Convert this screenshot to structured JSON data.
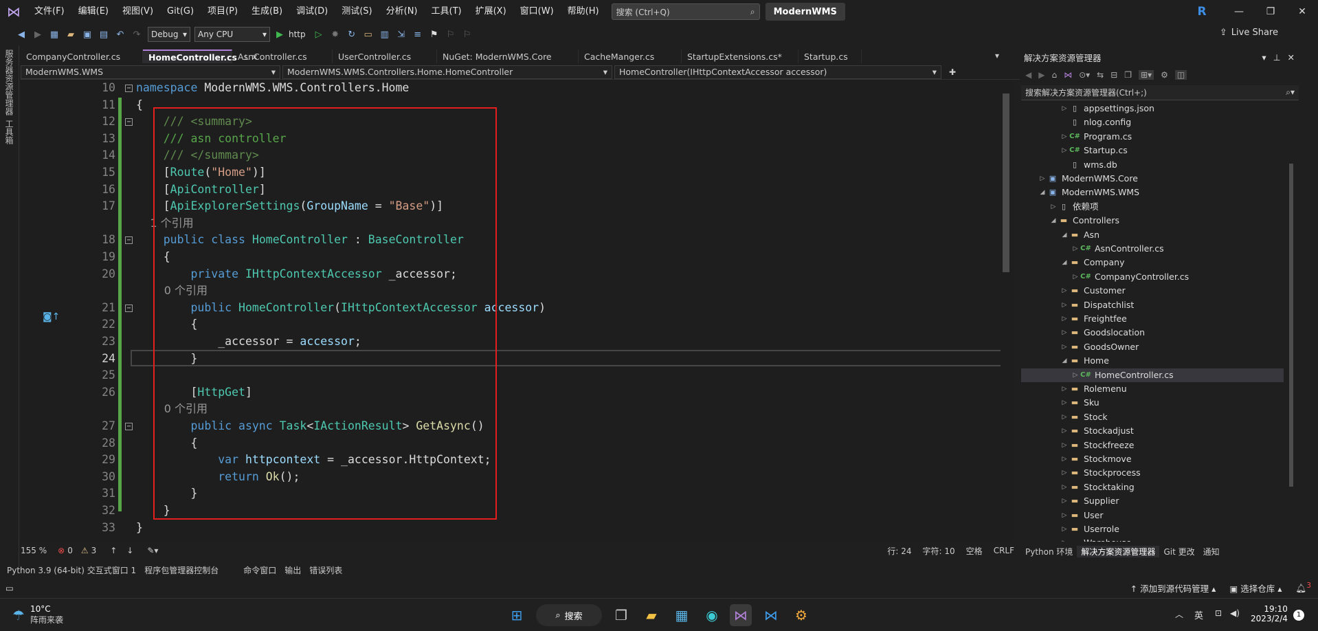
{
  "menu": {
    "items": [
      "文件(F)",
      "编辑(E)",
      "视图(V)",
      "Git(G)",
      "项目(P)",
      "生成(B)",
      "调试(D)",
      "测试(S)",
      "分析(N)",
      "工具(T)",
      "扩展(X)",
      "窗口(W)",
      "帮助(H)"
    ],
    "search_placeholder": "搜索 (Ctrl+Q)",
    "solution_name": "ModernWMS",
    "avatar_letter": "R"
  },
  "toolbar": {
    "config": "Debug",
    "platform": "Any CPU",
    "run_label": "http",
    "live_share": "Live Share"
  },
  "left_strip": {
    "item1": "服务器资源管理器",
    "item2": "工具箱"
  },
  "tabs": [
    {
      "label": "CompanyController.cs"
    },
    {
      "label": "HomeController.cs"
    },
    {
      "label": "AsnController.cs"
    },
    {
      "label": "UserController.cs"
    },
    {
      "label": "NuGet: ModernWMS.Core"
    },
    {
      "label": "CacheManger.cs"
    },
    {
      "label": "StartupExtensions.cs*"
    },
    {
      "label": "Startup.cs"
    }
  ],
  "navbar": {
    "project": "ModernWMS.WMS",
    "type": "ModernWMS.WMS.Controllers.Home.HomeController",
    "member": "HomeController(IHttpContextAccessor accessor)"
  },
  "code": {
    "lines": [
      {
        "n": "10",
        "spans": [
          {
            "c": "kw",
            "t": "namespace"
          },
          {
            "c": "",
            "t": " ModernWMS.WMS.Controllers.Home"
          }
        ]
      },
      {
        "n": "11",
        "spans": [
          {
            "c": "",
            "t": "{"
          }
        ]
      },
      {
        "n": "12",
        "spans": [
          {
            "c": "cmx",
            "t": "    /// <summary>"
          }
        ]
      },
      {
        "n": "13",
        "spans": [
          {
            "c": "cm",
            "t": "    /// asn controller"
          }
        ]
      },
      {
        "n": "14",
        "spans": [
          {
            "c": "cmx",
            "t": "    /// </summary>"
          }
        ]
      },
      {
        "n": "15",
        "spans": [
          {
            "c": "",
            "t": "    ["
          },
          {
            "c": "ty",
            "t": "Route"
          },
          {
            "c": "",
            "t": "("
          },
          {
            "c": "st",
            "t": "\"Home\""
          },
          {
            "c": "",
            "t": ")]"
          }
        ]
      },
      {
        "n": "16",
        "spans": [
          {
            "c": "",
            "t": "    ["
          },
          {
            "c": "ty",
            "t": "ApiController"
          },
          {
            "c": "",
            "t": "]"
          }
        ]
      },
      {
        "n": "17",
        "spans": [
          {
            "c": "",
            "t": "    ["
          },
          {
            "c": "ty",
            "t": "ApiExplorerSettings"
          },
          {
            "c": "",
            "t": "("
          },
          {
            "c": "id",
            "t": "GroupName"
          },
          {
            "c": "",
            "t": " = "
          },
          {
            "c": "st",
            "t": "\"Base\""
          },
          {
            "c": "",
            "t": ")]"
          }
        ]
      },
      {
        "hint": "    1 个引用"
      },
      {
        "n": "18",
        "spans": [
          {
            "c": "kw",
            "t": "    public class"
          },
          {
            "c": "",
            "t": " "
          },
          {
            "c": "ty",
            "t": "HomeController"
          },
          {
            "c": "",
            "t": " : "
          },
          {
            "c": "ty",
            "t": "BaseController"
          }
        ]
      },
      {
        "n": "19",
        "spans": [
          {
            "c": "",
            "t": "    {"
          }
        ]
      },
      {
        "n": "20",
        "spans": [
          {
            "c": "kw",
            "t": "        private"
          },
          {
            "c": "",
            "t": " "
          },
          {
            "c": "ty",
            "t": "IHttpContextAccessor"
          },
          {
            "c": "",
            "t": " _accessor;"
          }
        ]
      },
      {
        "hint": "        0 个引用"
      },
      {
        "n": "21",
        "spans": [
          {
            "c": "kw",
            "t": "        public"
          },
          {
            "c": "",
            "t": " "
          },
          {
            "c": "ty",
            "t": "HomeController"
          },
          {
            "c": "",
            "t": "("
          },
          {
            "c": "ty",
            "t": "IHttpContextAccessor"
          },
          {
            "c": "",
            "t": " "
          },
          {
            "c": "id",
            "t": "accessor"
          },
          {
            "c": "",
            "t": ")"
          }
        ]
      },
      {
        "n": "22",
        "spans": [
          {
            "c": "",
            "t": "        {"
          }
        ]
      },
      {
        "n": "23",
        "spans": [
          {
            "c": "",
            "t": "            _accessor = "
          },
          {
            "c": "id",
            "t": "accessor"
          },
          {
            "c": "",
            "t": ";"
          }
        ]
      },
      {
        "n": "24",
        "spans": [
          {
            "c": "",
            "t": "        }"
          }
        ]
      },
      {
        "n": "25",
        "spans": [
          {
            "c": "",
            "t": ""
          }
        ]
      },
      {
        "n": "26",
        "spans": [
          {
            "c": "",
            "t": "        ["
          },
          {
            "c": "ty",
            "t": "HttpGet"
          },
          {
            "c": "",
            "t": "]"
          }
        ]
      },
      {
        "hint": "        0 个引用"
      },
      {
        "n": "27",
        "spans": [
          {
            "c": "kw",
            "t": "        public async"
          },
          {
            "c": "",
            "t": " "
          },
          {
            "c": "ty",
            "t": "Task"
          },
          {
            "c": "",
            "t": "<"
          },
          {
            "c": "ty",
            "t": "IActionResult"
          },
          {
            "c": "",
            "t": "> "
          },
          {
            "c": "mt",
            "t": "GetAsync"
          },
          {
            "c": "",
            "t": "()"
          }
        ]
      },
      {
        "n": "28",
        "spans": [
          {
            "c": "",
            "t": "        {"
          }
        ]
      },
      {
        "n": "29",
        "spans": [
          {
            "c": "kw",
            "t": "            var"
          },
          {
            "c": "",
            "t": " "
          },
          {
            "c": "id",
            "t": "httpcontext"
          },
          {
            "c": "",
            "t": " = _accessor.HttpContext;"
          }
        ]
      },
      {
        "n": "30",
        "spans": [
          {
            "c": "kw",
            "t": "            return"
          },
          {
            "c": "",
            "t": " "
          },
          {
            "c": "mt",
            "t": "Ok"
          },
          {
            "c": "",
            "t": "();"
          }
        ]
      },
      {
        "n": "31",
        "spans": [
          {
            "c": "",
            "t": "        }"
          }
        ]
      },
      {
        "n": "32",
        "spans": [
          {
            "c": "",
            "t": "    }"
          }
        ]
      },
      {
        "n": "33",
        "spans": [
          {
            "c": "",
            "t": "}"
          }
        ]
      }
    ]
  },
  "editor_status": {
    "zoom": "155 %",
    "errors": "0",
    "warnings": "3",
    "line": "行: 24",
    "char": "字符: 10",
    "ws": "空格",
    "eol": "CRLF"
  },
  "solution_explorer": {
    "title": "解决方案资源管理器",
    "search_placeholder": "搜索解决方案资源管理器(Ctrl+;)",
    "nodes": [
      {
        "label": "appsettings.json",
        "indent": 3,
        "icon": "file",
        "arrow": "▷"
      },
      {
        "label": "nlog.config",
        "indent": 3,
        "icon": "file",
        "arrow": ""
      },
      {
        "label": "Program.cs",
        "indent": 3,
        "icon": "cs",
        "arrow": "▷"
      },
      {
        "label": "Startup.cs",
        "indent": 3,
        "icon": "cs",
        "arrow": "▷"
      },
      {
        "label": "wms.db",
        "indent": 3,
        "icon": "file",
        "arrow": ""
      },
      {
        "label": "ModernWMS.Core",
        "indent": 1,
        "icon": "proj",
        "arrow": "▷"
      },
      {
        "label": "ModernWMS.WMS",
        "indent": 1,
        "icon": "proj",
        "arrow": "◢"
      },
      {
        "label": "依赖项",
        "indent": 2,
        "icon": "file",
        "arrow": "▷"
      },
      {
        "label": "Controllers",
        "indent": 2,
        "icon": "folder",
        "arrow": "◢"
      },
      {
        "label": "Asn",
        "indent": 3,
        "icon": "folder",
        "arrow": "◢"
      },
      {
        "label": "AsnController.cs",
        "indent": 4,
        "icon": "cs",
        "arrow": "▷"
      },
      {
        "label": "Company",
        "indent": 3,
        "icon": "folder",
        "arrow": "◢"
      },
      {
        "label": "CompanyController.cs",
        "indent": 4,
        "icon": "cs",
        "arrow": "▷"
      },
      {
        "label": "Customer",
        "indent": 3,
        "icon": "folder",
        "arrow": "▷"
      },
      {
        "label": "Dispatchlist",
        "indent": 3,
        "icon": "folder",
        "arrow": "▷"
      },
      {
        "label": "Freightfee",
        "indent": 3,
        "icon": "folder",
        "arrow": "▷"
      },
      {
        "label": "Goodslocation",
        "indent": 3,
        "icon": "folder",
        "arrow": "▷"
      },
      {
        "label": "GoodsOwner",
        "indent": 3,
        "icon": "folder",
        "arrow": "▷"
      },
      {
        "label": "Home",
        "indent": 3,
        "icon": "folder",
        "arrow": "◢"
      },
      {
        "label": "HomeController.cs",
        "indent": 4,
        "icon": "cs",
        "arrow": "▷",
        "selected": true
      },
      {
        "label": "Rolemenu",
        "indent": 3,
        "icon": "folder",
        "arrow": "▷"
      },
      {
        "label": "Sku",
        "indent": 3,
        "icon": "folder",
        "arrow": "▷"
      },
      {
        "label": "Stock",
        "indent": 3,
        "icon": "folder",
        "arrow": "▷"
      },
      {
        "label": "Stockadjust",
        "indent": 3,
        "icon": "folder",
        "arrow": "▷"
      },
      {
        "label": "Stockfreeze",
        "indent": 3,
        "icon": "folder",
        "arrow": "▷"
      },
      {
        "label": "Stockmove",
        "indent": 3,
        "icon": "folder",
        "arrow": "▷"
      },
      {
        "label": "Stockprocess",
        "indent": 3,
        "icon": "folder",
        "arrow": "▷"
      },
      {
        "label": "Stocktaking",
        "indent": 3,
        "icon": "folder",
        "arrow": "▷"
      },
      {
        "label": "Supplier",
        "indent": 3,
        "icon": "folder",
        "arrow": "▷"
      },
      {
        "label": "User",
        "indent": 3,
        "icon": "folder",
        "arrow": "▷"
      },
      {
        "label": "Userrole",
        "indent": 3,
        "icon": "folder",
        "arrow": "▷"
      },
      {
        "label": "Warehouse",
        "indent": 3,
        "icon": "folder",
        "arrow": "▷"
      }
    ],
    "tabs": [
      "Python 环境",
      "解决方案资源管理器",
      "Git 更改",
      "通知"
    ]
  },
  "bottom_tabs": [
    "Python 3.9 (64-bit) 交互式窗口 1",
    "程序包管理器控制台",
    "命令窗口",
    "输出",
    "错误列表"
  ],
  "status_bar": {
    "source_control": "添加到源代码管理",
    "repo": "选择仓库",
    "notifications": "3"
  },
  "taskbar": {
    "weather_temp": "10°C",
    "weather_desc": "阵雨来袭",
    "search_label": "搜索",
    "ime": "英",
    "time": "19:10",
    "date": "2023/2/4",
    "badge": "1"
  }
}
